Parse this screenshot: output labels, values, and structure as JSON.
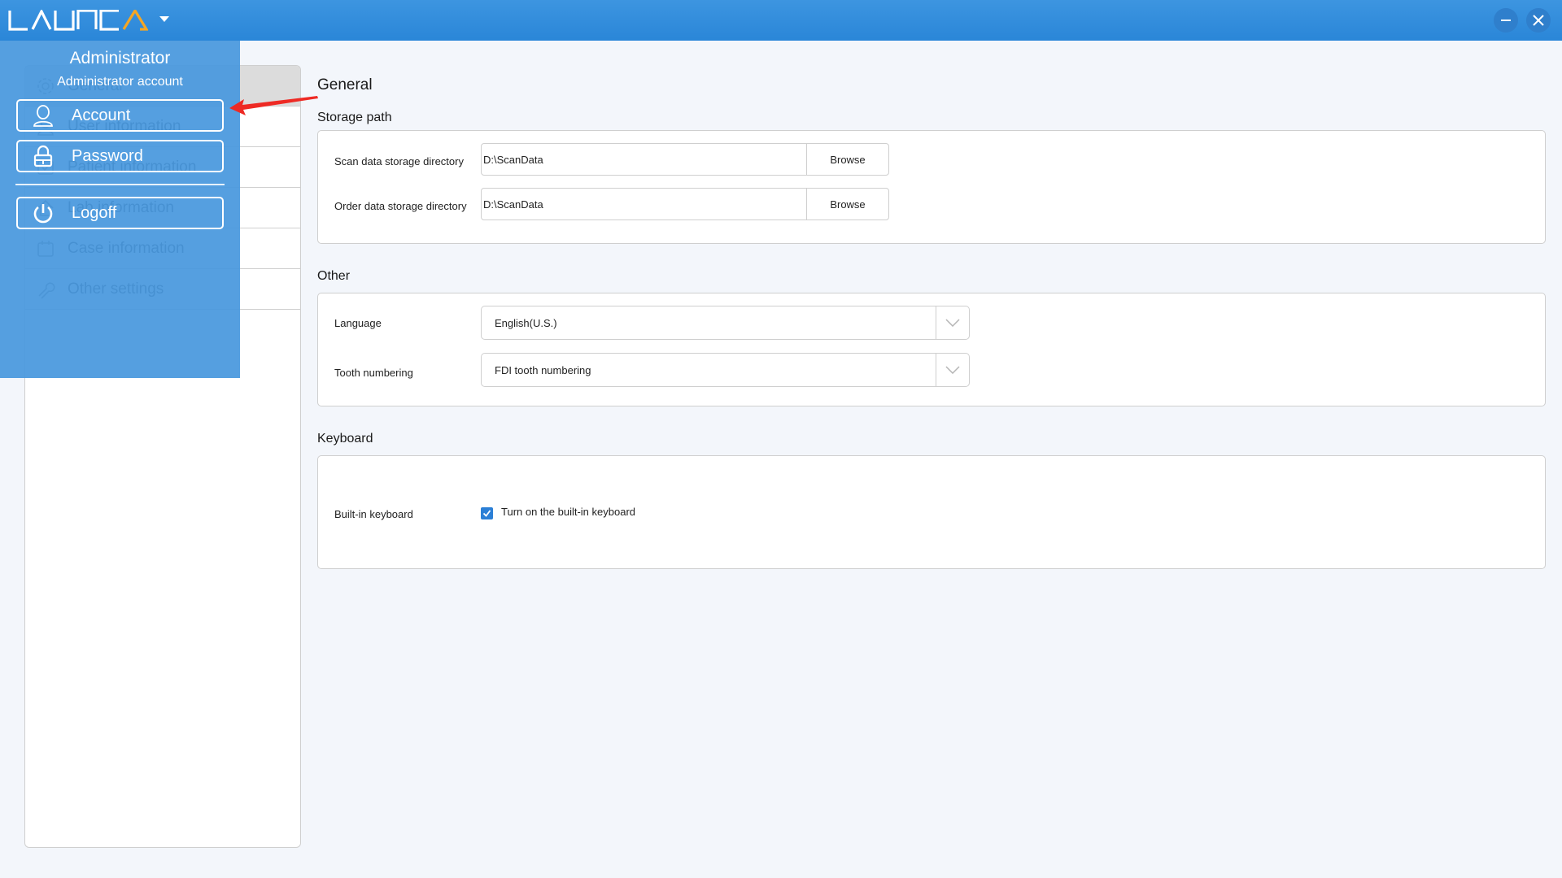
{
  "app": {
    "logo_text": "LAUNCA",
    "brand_color": "#2a86d8",
    "accent_color": "#f5a623"
  },
  "window_controls": {
    "minimize_icon": "minimize-icon",
    "close_icon": "close-icon"
  },
  "user_menu": {
    "title": "Administrator",
    "subtitle": "Administrator account",
    "items": [
      {
        "label": "Account",
        "icon": "user-icon"
      },
      {
        "label": "Password",
        "icon": "lock-icon"
      },
      {
        "label": "Logoff",
        "icon": "power-icon"
      }
    ]
  },
  "sidebar": {
    "items": [
      {
        "label": "General",
        "icon": "gear-icon",
        "active": true
      },
      {
        "label": "User information",
        "icon": "user-icon"
      },
      {
        "label": "Patient information",
        "icon": "patient-icon"
      },
      {
        "label": "Lab information",
        "icon": "home-icon"
      },
      {
        "label": "Case information",
        "icon": "calendar-icon"
      },
      {
        "label": "Other settings",
        "icon": "wrench-icon"
      }
    ]
  },
  "main": {
    "title": "General",
    "storage": {
      "heading": "Storage path",
      "rows": [
        {
          "label": "Scan data storage directory",
          "value": "D:\\ScanData",
          "button": "Browse"
        },
        {
          "label": "Order data storage directory",
          "value": "D:\\ScanData",
          "button": "Browse"
        }
      ]
    },
    "other": {
      "heading": "Other",
      "rows": [
        {
          "label": "Language",
          "value": "English(U.S.)"
        },
        {
          "label": "Tooth numbering",
          "value": "FDI tooth numbering"
        }
      ]
    },
    "keyboard": {
      "heading": "Keyboard",
      "label": "Built-in keyboard",
      "checkbox_label": "Turn on the built-in keyboard",
      "checked": true
    }
  }
}
